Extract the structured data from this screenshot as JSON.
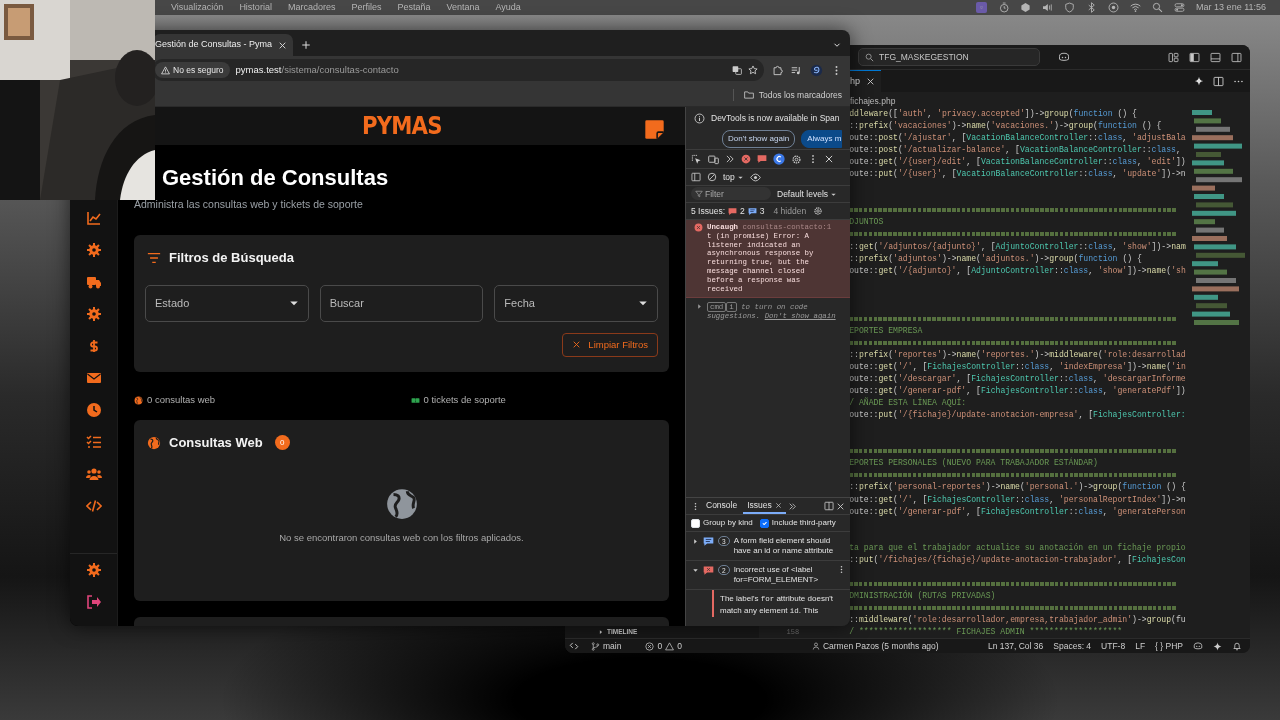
{
  "menubar": {
    "items": [
      "Visualización",
      "Historial",
      "Marcadores",
      "Perfiles",
      "Pestaña",
      "Ventana",
      "Ayuda"
    ],
    "clock": "Mar 13 ene 11:56"
  },
  "browser": {
    "tab": {
      "title": "Gestión de Consultas - Pyma",
      "selected": true
    },
    "security": "No es seguro",
    "url_host": "pymas.test",
    "url_path": "/sistema/consultas-contacto",
    "bookmarks_folder": "Todos los marcadores"
  },
  "page": {
    "logo": "PYMAS",
    "title": "Gestión de Consultas",
    "subtitle": "Administra las consultas web y tickets de soporte",
    "sidebar": [
      {
        "kind": "chart"
      },
      {
        "kind": "gear"
      },
      {
        "kind": "truck"
      },
      {
        "kind": "gear"
      },
      {
        "kind": "dollar"
      },
      {
        "kind": "envelope"
      },
      {
        "kind": "clock"
      },
      {
        "kind": "listcheck"
      },
      {
        "kind": "users"
      },
      {
        "kind": "code"
      }
    ],
    "sidebar_bottom": [
      {
        "kind": "gear"
      },
      {
        "kind": "logout"
      }
    ],
    "filters": {
      "title": "Filtros de Búsqueda",
      "fields": [
        {
          "kind": "select",
          "text": "Estado"
        },
        {
          "kind": "input",
          "placeholder": "Buscar"
        },
        {
          "kind": "select",
          "text": "Fecha"
        }
      ],
      "clear_button": "Limpiar Filtros"
    },
    "stats": [
      {
        "kind": "globe",
        "text": "0 consultas web"
      },
      {
        "kind": "ticket",
        "text": "0 tickets de soporte"
      }
    ],
    "web_card": {
      "title": "Consultas Web",
      "count": "0",
      "empty_text": "No se encontraron consultas web con los filtros aplicados."
    }
  },
  "devtools": {
    "banner": {
      "text": "DevTools is now available in Span",
      "buttons": [
        "Don't show again",
        "Always m"
      ]
    },
    "context": "top",
    "filter_placeholder": "Filter",
    "levels": "Default levels",
    "issues": {
      "label": "5 Issues:",
      "errors": "2",
      "infos": "3",
      "hidden": "4 hidden"
    },
    "error": {
      "title": "Uncaugh",
      "source": "consultas-contacto:1",
      "text": "t (in promise) Error: A listener indicated an asynchronous response by returning true, but the message channel closed before a response was received"
    },
    "hint": {
      "keys": [
        "cmd",
        "i"
      ],
      "text": "to turn on code suggestions.",
      "link": "Don't show again"
    },
    "drawer": {
      "tabs": [
        {
          "label": "Console",
          "selected": false,
          "closable": false
        },
        {
          "label": "Issues",
          "selected": true,
          "closable": true
        }
      ],
      "options": [
        {
          "label": "Group by kind",
          "checked": false
        },
        {
          "label": "Include third-party",
          "checked": true
        }
      ],
      "issues": [
        {
          "kind": "info",
          "count": "3",
          "title": "A form field element should have an id or name attribute",
          "expanded": false
        },
        {
          "kind": "error",
          "count": "2",
          "title": "Incorrect use of <label for=FORM_ELEMENT>",
          "expanded": true,
          "detail": [
            {
              "kind": "text",
              "text": "The label's "
            },
            {
              "kind": "code",
              "text": "for"
            },
            {
              "kind": "text",
              "text": " attribute doesn't match any element "
            },
            {
              "kind": "code",
              "text": "id"
            },
            {
              "kind": "text",
              "text": ". This"
            }
          ]
        }
      ]
    }
  },
  "vscode": {
    "search": "TFG_MASKEGESTION",
    "tab": {
      "label": "hp",
      "selected": true
    },
    "breadcrumb": "fichajes.php",
    "timeline": "TIMELINE",
    "line_number": "158",
    "code": [
      {
        "kind": "code",
        "tokens": [
          {
            "kind": "call",
            "text": "ddleware"
          },
          {
            "kind": "plain",
            "text": "(["
          },
          {
            "kind": "string",
            "text": "'auth'"
          },
          {
            "kind": "plain",
            "text": ", "
          },
          {
            "kind": "string",
            "text": "'privacy.accepted'"
          },
          {
            "kind": "plain",
            "text": "])->"
          },
          {
            "kind": "call",
            "text": "group"
          },
          {
            "kind": "plain",
            "text": "("
          },
          {
            "kind": "keyword",
            "text": "function"
          },
          {
            "kind": "plain",
            "text": " () {"
          }
        ]
      },
      {
        "kind": "code",
        "tokens": [
          {
            "kind": "plain",
            "text": "::"
          },
          {
            "kind": "call",
            "text": "prefix"
          },
          {
            "kind": "plain",
            "text": "("
          },
          {
            "kind": "string",
            "text": "'vacaciones'"
          },
          {
            "kind": "plain",
            "text": ")->"
          },
          {
            "kind": "call",
            "text": "name"
          },
          {
            "kind": "plain",
            "text": "("
          },
          {
            "kind": "string",
            "text": "'vacaciones.'"
          },
          {
            "kind": "plain",
            "text": ")->"
          },
          {
            "kind": "call",
            "text": "group"
          },
          {
            "kind": "plain",
            "text": "("
          },
          {
            "kind": "keyword",
            "text": "function"
          },
          {
            "kind": "plain",
            "text": " () {"
          }
        ]
      },
      {
        "kind": "code",
        "tokens": [
          {
            "kind": "plain",
            "text": "oute::"
          },
          {
            "kind": "call",
            "text": "post"
          },
          {
            "kind": "plain",
            "text": "("
          },
          {
            "kind": "string",
            "text": "'/ajustar'"
          },
          {
            "kind": "plain",
            "text": ", ["
          },
          {
            "kind": "type",
            "text": "VacationBalanceController"
          },
          {
            "kind": "plain",
            "text": "::"
          },
          {
            "kind": "keyword",
            "text": "class"
          },
          {
            "kind": "plain",
            "text": ", "
          },
          {
            "kind": "string",
            "text": "'adjustBala"
          }
        ]
      },
      {
        "kind": "code",
        "tokens": [
          {
            "kind": "plain",
            "text": "oute::"
          },
          {
            "kind": "call",
            "text": "post"
          },
          {
            "kind": "plain",
            "text": "("
          },
          {
            "kind": "string",
            "text": "'/actualizar-balance'"
          },
          {
            "kind": "plain",
            "text": ", ["
          },
          {
            "kind": "type",
            "text": "VacationBalanceController"
          },
          {
            "kind": "plain",
            "text": "::"
          },
          {
            "kind": "keyword",
            "text": "class"
          },
          {
            "kind": "plain",
            "text": ","
          }
        ]
      },
      {
        "kind": "code",
        "tokens": [
          {
            "kind": "plain",
            "text": "oute::"
          },
          {
            "kind": "call",
            "text": "get"
          },
          {
            "kind": "plain",
            "text": "("
          },
          {
            "kind": "string",
            "text": "'/{user}/edit'"
          },
          {
            "kind": "plain",
            "text": ", ["
          },
          {
            "kind": "type",
            "text": "VacationBalanceController"
          },
          {
            "kind": "plain",
            "text": "::"
          },
          {
            "kind": "keyword",
            "text": "class"
          },
          {
            "kind": "plain",
            "text": ", "
          },
          {
            "kind": "string",
            "text": "'edit'"
          },
          {
            "kind": "plain",
            "text": "])"
          }
        ]
      },
      {
        "kind": "code",
        "tokens": [
          {
            "kind": "plain",
            "text": "oute::"
          },
          {
            "kind": "call",
            "text": "put"
          },
          {
            "kind": "plain",
            "text": "("
          },
          {
            "kind": "string",
            "text": "'/{user}'"
          },
          {
            "kind": "plain",
            "text": ", ["
          },
          {
            "kind": "type",
            "text": "VacationBalanceController"
          },
          {
            "kind": "plain",
            "text": "::"
          },
          {
            "kind": "keyword",
            "text": "class"
          },
          {
            "kind": "plain",
            "text": ", "
          },
          {
            "kind": "string",
            "text": "'update'"
          },
          {
            "kind": "plain",
            "text": "])->n"
          }
        ]
      },
      {
        "kind": "blank"
      },
      {
        "kind": "blank"
      },
      {
        "kind": "rule"
      },
      {
        "kind": "code",
        "tokens": [
          {
            "kind": "comment",
            "text": "DJUNTOS"
          }
        ]
      },
      {
        "kind": "rule"
      },
      {
        "kind": "code",
        "tokens": [
          {
            "kind": "plain",
            "text": "::"
          },
          {
            "kind": "call",
            "text": "get"
          },
          {
            "kind": "plain",
            "text": "("
          },
          {
            "kind": "string",
            "text": "'/adjuntos/{adjunto}'"
          },
          {
            "kind": "plain",
            "text": ", ["
          },
          {
            "kind": "type",
            "text": "AdjuntoController"
          },
          {
            "kind": "plain",
            "text": "::"
          },
          {
            "kind": "keyword",
            "text": "class"
          },
          {
            "kind": "plain",
            "text": ", "
          },
          {
            "kind": "string",
            "text": "'show'"
          },
          {
            "kind": "plain",
            "text": "])->"
          },
          {
            "kind": "call",
            "text": "nam"
          }
        ]
      },
      {
        "kind": "code",
        "tokens": [
          {
            "kind": "plain",
            "text": "::"
          },
          {
            "kind": "call",
            "text": "prefix"
          },
          {
            "kind": "plain",
            "text": "("
          },
          {
            "kind": "string",
            "text": "'adjuntos'"
          },
          {
            "kind": "plain",
            "text": ")->"
          },
          {
            "kind": "call",
            "text": "name"
          },
          {
            "kind": "plain",
            "text": "("
          },
          {
            "kind": "string",
            "text": "'adjuntos.'"
          },
          {
            "kind": "plain",
            "text": ")->"
          },
          {
            "kind": "call",
            "text": "group"
          },
          {
            "kind": "plain",
            "text": "("
          },
          {
            "kind": "keyword",
            "text": "function"
          },
          {
            "kind": "plain",
            "text": " () {"
          }
        ]
      },
      {
        "kind": "code",
        "tokens": [
          {
            "kind": "plain",
            "text": "oute::"
          },
          {
            "kind": "call",
            "text": "get"
          },
          {
            "kind": "plain",
            "text": "("
          },
          {
            "kind": "string",
            "text": "'/{adjunto}'"
          },
          {
            "kind": "plain",
            "text": ", ["
          },
          {
            "kind": "type",
            "text": "AdjuntoController"
          },
          {
            "kind": "plain",
            "text": "::"
          },
          {
            "kind": "keyword",
            "text": "class"
          },
          {
            "kind": "plain",
            "text": ", "
          },
          {
            "kind": "string",
            "text": "'show'"
          },
          {
            "kind": "plain",
            "text": "])->"
          },
          {
            "kind": "call",
            "text": "name"
          },
          {
            "kind": "plain",
            "text": "("
          },
          {
            "kind": "string",
            "text": "'sh"
          }
        ]
      },
      {
        "kind": "blank"
      },
      {
        "kind": "blank"
      },
      {
        "kind": "blank"
      },
      {
        "kind": "rule"
      },
      {
        "kind": "code",
        "tokens": [
          {
            "kind": "comment",
            "text": "EPORTES EMPRESA"
          }
        ]
      },
      {
        "kind": "rule"
      },
      {
        "kind": "code",
        "tokens": [
          {
            "kind": "plain",
            "text": "::"
          },
          {
            "kind": "call",
            "text": "prefix"
          },
          {
            "kind": "plain",
            "text": "("
          },
          {
            "kind": "string",
            "text": "'reportes'"
          },
          {
            "kind": "plain",
            "text": ")->"
          },
          {
            "kind": "call",
            "text": "name"
          },
          {
            "kind": "plain",
            "text": "("
          },
          {
            "kind": "string",
            "text": "'reportes.'"
          },
          {
            "kind": "plain",
            "text": ")->"
          },
          {
            "kind": "call",
            "text": "middleware"
          },
          {
            "kind": "plain",
            "text": "("
          },
          {
            "kind": "string",
            "text": "'role:desarrollad"
          }
        ]
      },
      {
        "kind": "code",
        "tokens": [
          {
            "kind": "plain",
            "text": "oute::"
          },
          {
            "kind": "call",
            "text": "get"
          },
          {
            "kind": "plain",
            "text": "("
          },
          {
            "kind": "string",
            "text": "'/'"
          },
          {
            "kind": "plain",
            "text": ", ["
          },
          {
            "kind": "type",
            "text": "FichajesController"
          },
          {
            "kind": "plain",
            "text": "::"
          },
          {
            "kind": "keyword",
            "text": "class"
          },
          {
            "kind": "plain",
            "text": ", "
          },
          {
            "kind": "string",
            "text": "'indexEmpresa'"
          },
          {
            "kind": "plain",
            "text": "])->"
          },
          {
            "kind": "call",
            "text": "name"
          },
          {
            "kind": "plain",
            "text": "("
          },
          {
            "kind": "string",
            "text": "'in"
          }
        ]
      },
      {
        "kind": "code",
        "tokens": [
          {
            "kind": "plain",
            "text": "oute::"
          },
          {
            "kind": "call",
            "text": "get"
          },
          {
            "kind": "plain",
            "text": "("
          },
          {
            "kind": "string",
            "text": "'/descargar'"
          },
          {
            "kind": "plain",
            "text": ", ["
          },
          {
            "kind": "type",
            "text": "FichajesController"
          },
          {
            "kind": "plain",
            "text": "::"
          },
          {
            "kind": "keyword",
            "text": "class"
          },
          {
            "kind": "plain",
            "text": ", "
          },
          {
            "kind": "string",
            "text": "'descargarInforme"
          }
        ]
      },
      {
        "kind": "code",
        "tokens": [
          {
            "kind": "plain",
            "text": "oute::"
          },
          {
            "kind": "call",
            "text": "get"
          },
          {
            "kind": "plain",
            "text": "("
          },
          {
            "kind": "string",
            "text": "'/generar-pdf'"
          },
          {
            "kind": "plain",
            "text": ", ["
          },
          {
            "kind": "type",
            "text": "FichajesController"
          },
          {
            "kind": "plain",
            "text": "::"
          },
          {
            "kind": "keyword",
            "text": "class"
          },
          {
            "kind": "plain",
            "text": ", "
          },
          {
            "kind": "string",
            "text": "'generatePdf'"
          },
          {
            "kind": "plain",
            "text": "])"
          }
        ]
      },
      {
        "kind": "code",
        "tokens": [
          {
            "kind": "comment",
            "text": "/ AÑADE ESTA LÍNEA AQUÍ:"
          }
        ]
      },
      {
        "kind": "code",
        "tokens": [
          {
            "kind": "plain",
            "text": "oute::"
          },
          {
            "kind": "call",
            "text": "put"
          },
          {
            "kind": "plain",
            "text": "("
          },
          {
            "kind": "string",
            "text": "'/{fichaje}/update-anotacion-empresa'"
          },
          {
            "kind": "plain",
            "text": ", ["
          },
          {
            "kind": "type",
            "text": "FichajesController:"
          }
        ]
      },
      {
        "kind": "blank"
      },
      {
        "kind": "blank"
      },
      {
        "kind": "rule"
      },
      {
        "kind": "code",
        "tokens": [
          {
            "kind": "comment",
            "text": "EPORTES PERSONALES (NUEVO PARA TRABAJADOR ESTÁNDAR)"
          }
        ]
      },
      {
        "kind": "rule"
      },
      {
        "kind": "code",
        "tokens": [
          {
            "kind": "plain",
            "text": "::"
          },
          {
            "kind": "call",
            "text": "prefix"
          },
          {
            "kind": "plain",
            "text": "("
          },
          {
            "kind": "string",
            "text": "'personal-reportes'"
          },
          {
            "kind": "plain",
            "text": ")->"
          },
          {
            "kind": "call",
            "text": "name"
          },
          {
            "kind": "plain",
            "text": "("
          },
          {
            "kind": "string",
            "text": "'personal.'"
          },
          {
            "kind": "plain",
            "text": ")->"
          },
          {
            "kind": "call",
            "text": "group"
          },
          {
            "kind": "plain",
            "text": "("
          },
          {
            "kind": "keyword",
            "text": "function"
          },
          {
            "kind": "plain",
            "text": " () {"
          }
        ]
      },
      {
        "kind": "code",
        "tokens": [
          {
            "kind": "plain",
            "text": "oute::"
          },
          {
            "kind": "call",
            "text": "get"
          },
          {
            "kind": "plain",
            "text": "("
          },
          {
            "kind": "string",
            "text": "'/'"
          },
          {
            "kind": "plain",
            "text": ", ["
          },
          {
            "kind": "type",
            "text": "FichajesController"
          },
          {
            "kind": "plain",
            "text": "::"
          },
          {
            "kind": "keyword",
            "text": "class"
          },
          {
            "kind": "plain",
            "text": ", "
          },
          {
            "kind": "string",
            "text": "'personalReportIndex'"
          },
          {
            "kind": "plain",
            "text": "])->n"
          }
        ]
      },
      {
        "kind": "code",
        "tokens": [
          {
            "kind": "plain",
            "text": "oute::"
          },
          {
            "kind": "call",
            "text": "get"
          },
          {
            "kind": "plain",
            "text": "("
          },
          {
            "kind": "string",
            "text": "'/generar-pdf'"
          },
          {
            "kind": "plain",
            "text": ", ["
          },
          {
            "kind": "type",
            "text": "FichajesController"
          },
          {
            "kind": "plain",
            "text": "::"
          },
          {
            "kind": "keyword",
            "text": "class"
          },
          {
            "kind": "plain",
            "text": ", "
          },
          {
            "kind": "string",
            "text": "'generatePerson"
          }
        ]
      },
      {
        "kind": "blank"
      },
      {
        "kind": "blank"
      },
      {
        "kind": "code",
        "tokens": [
          {
            "kind": "comment",
            "text": "ta para que el trabajador actualice su anotación en un fichaje propio"
          }
        ]
      },
      {
        "kind": "code",
        "tokens": [
          {
            "kind": "plain",
            "text": "::"
          },
          {
            "kind": "call",
            "text": "put"
          },
          {
            "kind": "plain",
            "text": "("
          },
          {
            "kind": "string",
            "text": "'/fichajes/{fichaje}/update-anotacion-trabajador'"
          },
          {
            "kind": "plain",
            "text": ", ["
          },
          {
            "kind": "type",
            "text": "FichajesCon"
          }
        ]
      },
      {
        "kind": "blank"
      },
      {
        "kind": "rule"
      },
      {
        "kind": "code",
        "tokens": [
          {
            "kind": "comment",
            "text": "DMINISTRACIÓN (RUTAS PRIVADAS)"
          }
        ]
      },
      {
        "kind": "rule"
      },
      {
        "kind": "code",
        "tokens": [
          {
            "kind": "plain",
            "text": "::"
          },
          {
            "kind": "call",
            "text": "middleware"
          },
          {
            "kind": "plain",
            "text": "("
          },
          {
            "kind": "string",
            "text": "'role:desarrollador,empresa,trabajador_admin'"
          },
          {
            "kind": "plain",
            "text": ")->"
          },
          {
            "kind": "call",
            "text": "group"
          },
          {
            "kind": "plain",
            "text": "(fu"
          }
        ]
      },
      {
        "kind": "code",
        "tokens": [
          {
            "kind": "comment",
            "text": "/ ******************* FICHAJES ADMIN *******************"
          }
        ]
      }
    ],
    "status": {
      "branch": "main",
      "errors": "0",
      "warnings": "0",
      "blame": "Carmen Pazos (5 months ago)",
      "position": "Ln 137, Col 36",
      "spaces": "Spaces: 4",
      "encoding": "UTF-8",
      "eol": "LF",
      "language_glyph": "{ }",
      "language": "PHP"
    }
  }
}
